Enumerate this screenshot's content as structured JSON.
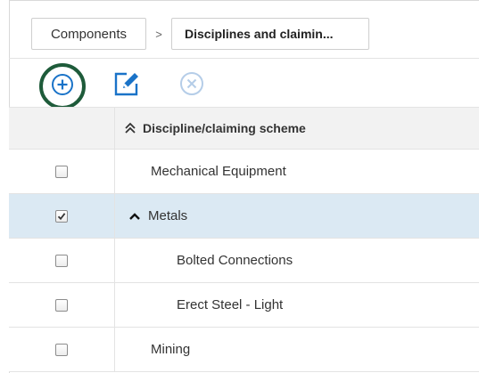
{
  "breadcrumb": {
    "items": [
      "Components",
      "Disciplines and claimin..."
    ],
    "separator": ">"
  },
  "toolbar": {
    "add_icon": "plus-circle-icon",
    "edit_icon": "edit-pencil-icon",
    "remove_icon": "x-circle-icon"
  },
  "grid": {
    "column_header": "Discipline/claiming scheme",
    "rows": [
      {
        "label": "Mechanical Equipment",
        "checked": false
      },
      {
        "label": "Metals",
        "checked": true
      },
      {
        "label": "Bolted Connections",
        "checked": false
      },
      {
        "label": "Erect Steel - Light",
        "checked": false
      },
      {
        "label": "Mining",
        "checked": false
      }
    ]
  },
  "colors": {
    "accent_blue": "#1a73c8",
    "highlight_ring": "#1e5b3a",
    "selected_row": "#dbe9f3",
    "disabled_icon": "#b5cde8"
  }
}
